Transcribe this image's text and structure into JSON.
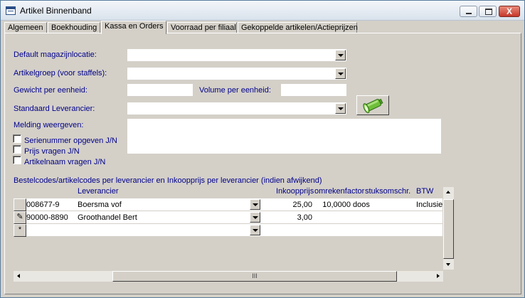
{
  "window": {
    "title": "Artikel Binnenband",
    "minimize_icon": "minimize-icon",
    "maximize_icon": "maximize-icon",
    "close_label": "X"
  },
  "tabs": [
    {
      "label": "Algemeen",
      "active": false
    },
    {
      "label": "Boekhouding",
      "active": false
    },
    {
      "label": "Kassa en Orders",
      "active": true
    },
    {
      "label": "Voorraad per filiaal",
      "active": false
    },
    {
      "label": "Gekoppelde artikelen/Actieprijzen",
      "active": false
    }
  ],
  "form": {
    "default_location_label": "Default magazijnlocatie:",
    "default_location_value": "",
    "article_group_label": "Artikelgroep (voor staffels):",
    "article_group_value": "",
    "weight_label": "Gewicht per eenheid:",
    "weight_value": "",
    "volume_label": "Volume per eenheid:",
    "volume_value": "",
    "supplier_label": "Standaard Leverancier:",
    "supplier_value": "",
    "message_label": "Melding weergeven:",
    "message_value": "",
    "serial_label": "Serienummer opgeven J/N",
    "serial_checked": false,
    "price_label": "Prijs vragen J/N",
    "price_checked": false,
    "name_label": "Artikelnaam vragen J/N",
    "name_checked": false,
    "lookup_icon": "flashlight-icon"
  },
  "orders": {
    "section_title": "Bestelcodes/artikelcodes per leverancier en Inkoopprijs per leverancier (indien afwijkend)",
    "headers": {
      "supplier": "Leverancier",
      "purchase_price": "Inkoopprijs",
      "conversion": "omrekenfactor",
      "unit": "stuksomschr.",
      "vat": "BTW"
    },
    "rows": [
      {
        "marker": "",
        "code": "008677-9",
        "supplier": "Boersma vof",
        "price": "25,00",
        "factor": "10,0000",
        "unit": "doos",
        "vat": "Inclusie"
      },
      {
        "marker": "✎",
        "code": "90000-8890",
        "supplier": "Groothandel Bert",
        "price": "3,00",
        "factor": "",
        "unit": "",
        "vat": ""
      },
      {
        "marker": "*",
        "code": "",
        "supplier": "",
        "price": "",
        "factor": "",
        "unit": "",
        "vat": ""
      }
    ],
    "hscroll_grip": "III"
  }
}
